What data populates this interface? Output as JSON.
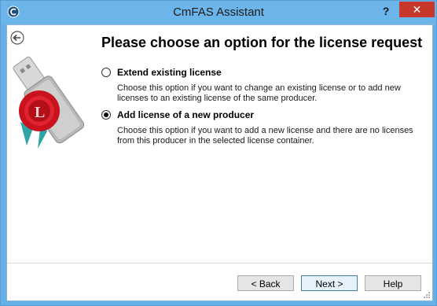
{
  "window": {
    "title": "CmFAS Assistant",
    "help_label": "?",
    "close_label": "✕"
  },
  "page": {
    "heading": "Please choose an option for the license request"
  },
  "options": [
    {
      "label": "Extend existing license",
      "description": "Choose this option if you want to change an existing license or to add new licenses to an existing license of the same producer.",
      "selected": false
    },
    {
      "label": "Add license of a new producer",
      "description": "Choose this option if you want to add a new license and there are no licenses from this producer in the selected license container.",
      "selected": true
    }
  ],
  "buttons": {
    "back": "< Back",
    "next": "Next >",
    "help": "Help"
  },
  "colors": {
    "title_bar": "#6cb5ea",
    "close_button": "#c7372c"
  },
  "icons": {
    "app": "codemeter-icon",
    "back": "back-arrow-icon",
    "logo": "usb-license-seal-icon"
  }
}
